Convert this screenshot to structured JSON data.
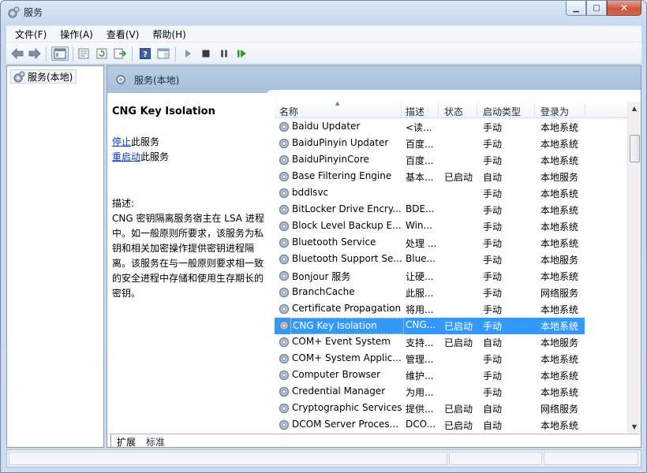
{
  "window": {
    "title": "服务",
    "caption": {
      "minimize": "▁",
      "maximize": "□",
      "close": "✕"
    }
  },
  "menu": [
    "文件(F)",
    "操作(A)",
    "查看(V)",
    "帮助(H)"
  ],
  "toolbar": {
    "icons": [
      "back-arrow-icon",
      "forward-arrow-icon",
      "console-tree-icon",
      "properties-icon",
      "refresh-icon",
      "export-list-icon",
      "help-icon",
      "show-hide-icon",
      "start-service-icon",
      "stop-service-icon",
      "pause-service-icon",
      "restart-service-icon"
    ]
  },
  "tree": {
    "root_label": "服务(本地)"
  },
  "main": {
    "header_title": "服务(本地)",
    "selected_service": "CNG Key Isolation",
    "stop_link": "停止",
    "stop_suffix": "此服务",
    "restart_link": "重启动",
    "restart_suffix": "此服务",
    "desc_label": "描述:",
    "desc_text": "CNG 密钥隔离服务宿主在 LSA 进程中。如一般原则所要求，该服务为私钥和相关加密操作提供密钥进程隔离。该服务在与一般原则要求相一致的安全进程中存储和使用生存期长的密钥。"
  },
  "columns": {
    "name": "名称",
    "desc": "描述",
    "status": "状态",
    "startup": "启动类型",
    "logon": "登录为"
  },
  "services": [
    {
      "name": "Baidu Updater",
      "desc": "<读...",
      "status": "",
      "startup": "手动",
      "logon": "本地系统"
    },
    {
      "name": "BaiduPinyin Updater",
      "desc": "百度...",
      "status": "",
      "startup": "手动",
      "logon": "本地系统"
    },
    {
      "name": "BaiduPinyinCore",
      "desc": "百度...",
      "status": "",
      "startup": "手动",
      "logon": "本地系统"
    },
    {
      "name": "Base Filtering Engine",
      "desc": "基本...",
      "status": "已启动",
      "startup": "自动",
      "logon": "本地服务"
    },
    {
      "name": "bddlsvc",
      "desc": "",
      "status": "",
      "startup": "手动",
      "logon": "本地系统"
    },
    {
      "name": "BitLocker Drive Encry...",
      "desc": "BDE...",
      "status": "",
      "startup": "手动",
      "logon": "本地系统"
    },
    {
      "name": "Block Level Backup E...",
      "desc": "Win...",
      "status": "",
      "startup": "手动",
      "logon": "本地系统"
    },
    {
      "name": "Bluetooth Service",
      "desc": "处理 ...",
      "status": "",
      "startup": "手动",
      "logon": "本地系统"
    },
    {
      "name": "Bluetooth Support Se...",
      "desc": "Blue...",
      "status": "",
      "startup": "手动",
      "logon": "本地服务"
    },
    {
      "name": "Bonjour 服务",
      "desc": "让硬...",
      "status": "",
      "startup": "手动",
      "logon": "本地系统"
    },
    {
      "name": "BranchCache",
      "desc": "此服...",
      "status": "",
      "startup": "手动",
      "logon": "网络服务"
    },
    {
      "name": "Certificate Propagation",
      "desc": "将用...",
      "status": "",
      "startup": "手动",
      "logon": "本地系统"
    },
    {
      "name": "CNG Key Isolation",
      "desc": "CNG...",
      "status": "已启动",
      "startup": "手动",
      "logon": "本地系统"
    },
    {
      "name": "COM+ Event System",
      "desc": "支持...",
      "status": "已启动",
      "startup": "自动",
      "logon": "本地服务"
    },
    {
      "name": "COM+ System Applic...",
      "desc": "管理...",
      "status": "",
      "startup": "手动",
      "logon": "本地系统"
    },
    {
      "name": "Computer Browser",
      "desc": "维护...",
      "status": "",
      "startup": "手动",
      "logon": "本地系统"
    },
    {
      "name": "Credential Manager",
      "desc": "为用...",
      "status": "",
      "startup": "手动",
      "logon": "本地系统"
    },
    {
      "name": "Cryptographic Services",
      "desc": "提供...",
      "status": "已启动",
      "startup": "自动",
      "logon": "网络服务"
    },
    {
      "name": "DCOM Server Proces...",
      "desc": "DCO...",
      "status": "已启动",
      "startup": "自动",
      "logon": "本地系统"
    }
  ],
  "tabs": {
    "extended": "扩展",
    "standard": "标准"
  }
}
